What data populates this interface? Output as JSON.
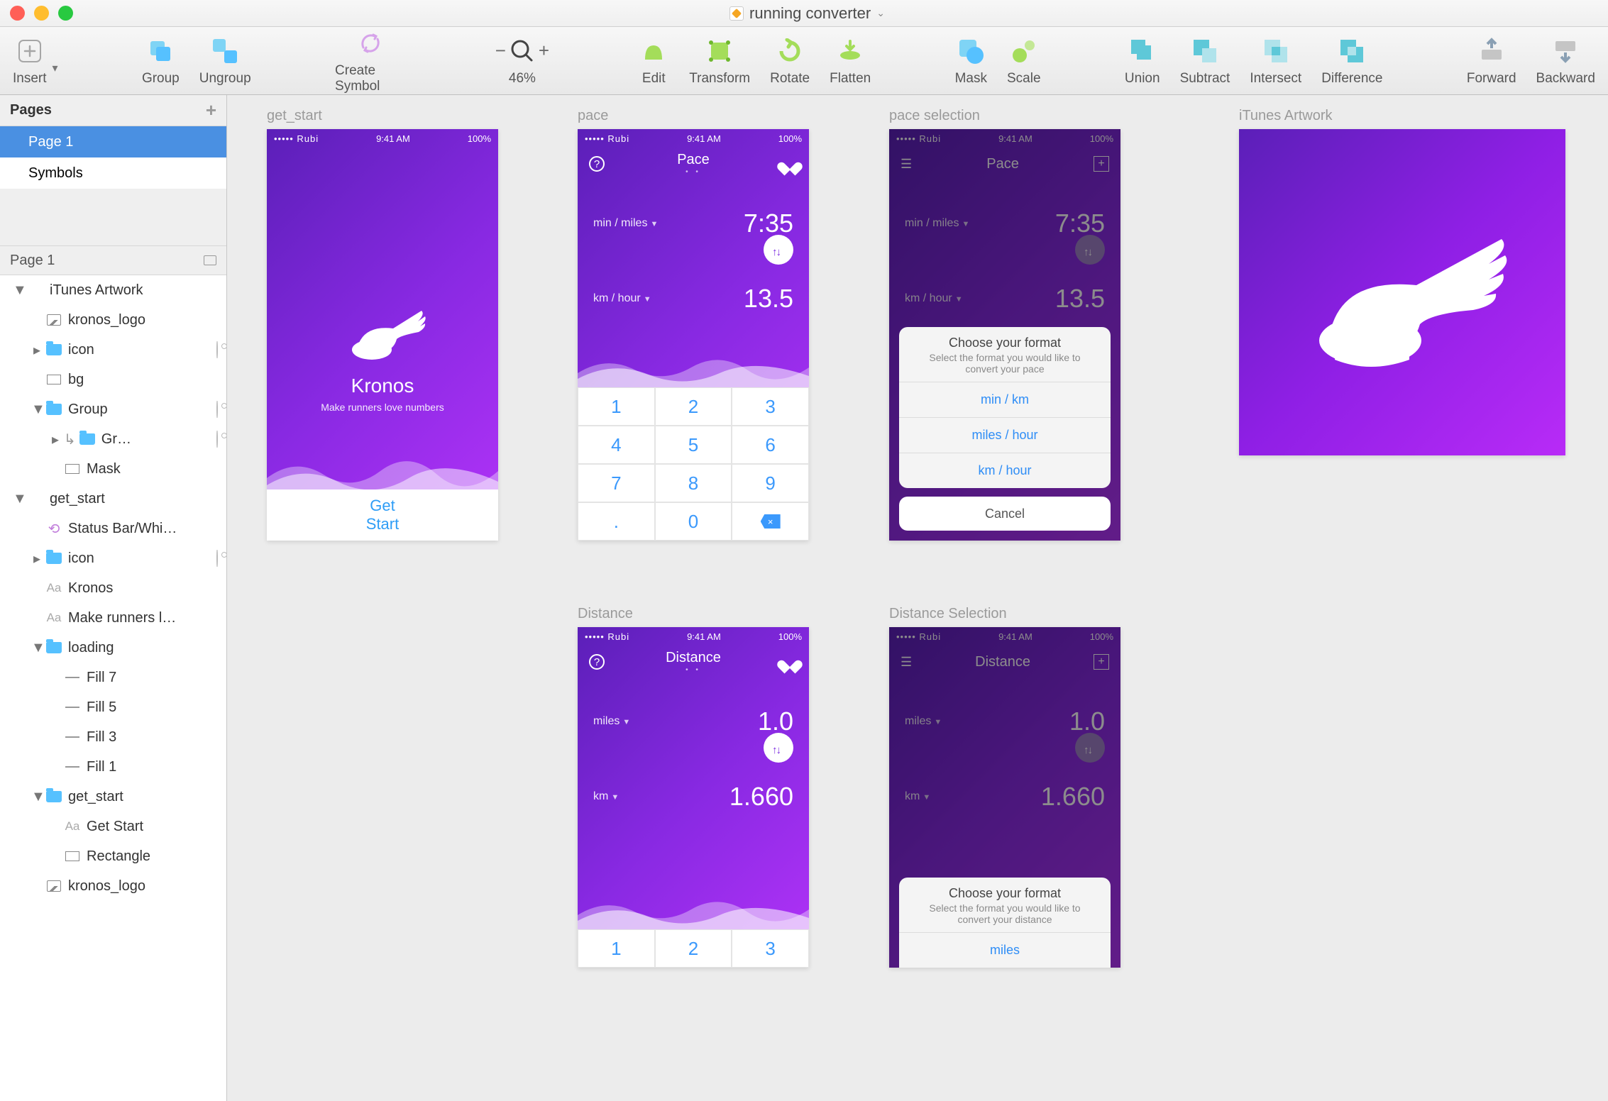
{
  "window": {
    "title": "running converter"
  },
  "toolbar": {
    "insert": "Insert",
    "group": "Group",
    "ungroup": "Ungroup",
    "createSymbol": "Create Symbol",
    "zoom": "46%",
    "edit": "Edit",
    "transform": "Transform",
    "rotate": "Rotate",
    "flatten": "Flatten",
    "mask": "Mask",
    "scale": "Scale",
    "union": "Union",
    "subtract": "Subtract",
    "intersect": "Intersect",
    "difference": "Difference",
    "forward": "Forward",
    "backward": "Backward"
  },
  "sidebar": {
    "pagesHeader": "Pages",
    "pages": [
      "Page 1",
      "Symbols"
    ],
    "sectionHeader": "Page 1",
    "layers": [
      {
        "depth": 0,
        "disclosure": "▼",
        "icon": "",
        "name": "iTunes Artwork"
      },
      {
        "depth": 1,
        "disclosure": "",
        "icon": "img",
        "name": "kronos_logo"
      },
      {
        "depth": 1,
        "disclosure": "▸",
        "icon": "folder",
        "name": "icon",
        "vis": true
      },
      {
        "depth": 1,
        "disclosure": "",
        "icon": "rect",
        "name": "bg"
      },
      {
        "depth": 1,
        "disclosure": "▼",
        "icon": "folder",
        "name": "Group",
        "vis": true
      },
      {
        "depth": 2,
        "disclosure": "▸",
        "icon": "folder",
        "name": "Gr…",
        "vis": true,
        "link": true
      },
      {
        "depth": 2,
        "disclosure": "",
        "icon": "rect",
        "name": "Mask"
      },
      {
        "depth": 0,
        "disclosure": "▼",
        "icon": "",
        "name": "get_start"
      },
      {
        "depth": 1,
        "disclosure": "",
        "icon": "sym",
        "name": "Status Bar/Whi…"
      },
      {
        "depth": 1,
        "disclosure": "▸",
        "icon": "folder",
        "name": "icon",
        "vis": true
      },
      {
        "depth": 1,
        "disclosure": "",
        "icon": "txt",
        "name": "Kronos"
      },
      {
        "depth": 1,
        "disclosure": "",
        "icon": "txt",
        "name": "Make runners l…"
      },
      {
        "depth": 1,
        "disclosure": "▼",
        "icon": "folder",
        "name": "loading"
      },
      {
        "depth": 2,
        "disclosure": "",
        "icon": "line",
        "name": "Fill 7"
      },
      {
        "depth": 2,
        "disclosure": "",
        "icon": "line",
        "name": "Fill 5"
      },
      {
        "depth": 2,
        "disclosure": "",
        "icon": "line",
        "name": "Fill 3"
      },
      {
        "depth": 2,
        "disclosure": "",
        "icon": "line",
        "name": "Fill 1"
      },
      {
        "depth": 1,
        "disclosure": "▼",
        "icon": "folder",
        "name": "get_start"
      },
      {
        "depth": 2,
        "disclosure": "",
        "icon": "txt",
        "name": "Get Start"
      },
      {
        "depth": 2,
        "disclosure": "",
        "icon": "rect",
        "name": "Rectangle"
      },
      {
        "depth": 1,
        "disclosure": "",
        "icon": "img",
        "name": "kronos_logo"
      }
    ]
  },
  "artboards": {
    "getStart": {
      "label": "get_start",
      "carrier": "••••• Rubi",
      "time": "9:41 AM",
      "batt": "100%",
      "title": "Kronos",
      "sub": "Make runners love numbers",
      "cta1": "Get",
      "cta2": "Start"
    },
    "pace": {
      "label": "pace",
      "title": "Pace",
      "unit1": "min / miles",
      "val1": "7:35",
      "unit2": "km / hour",
      "val2": "13.5",
      "keys": [
        "1",
        "2",
        "3",
        "4",
        "5",
        "6",
        "7",
        "8",
        "9",
        ".",
        "0",
        "⌫"
      ]
    },
    "paceSel": {
      "label": "pace selection",
      "sheetTitle": "Choose your format",
      "sheetSub": "Select the format you would like to convert your pace",
      "opts": [
        "min / km",
        "miles / hour",
        "km / hour"
      ],
      "cancel": "Cancel"
    },
    "itunes": {
      "label": "iTunes Artwork"
    },
    "distance": {
      "label": "Distance",
      "title": "Distance",
      "unit1": "miles",
      "val1": "1.0",
      "unit2": "km",
      "val2": "1.660",
      "keysRow": [
        "1",
        "2",
        "3"
      ]
    },
    "distSel": {
      "label": "Distance Selection",
      "sheetTitle": "Choose your format",
      "sheetSub": "Select the format you would like to convert your distance",
      "opts": [
        "miles"
      ]
    }
  },
  "status": {
    "carrier": "••••• Rubi",
    "time": "9:41 AM",
    "batt": "100%"
  }
}
